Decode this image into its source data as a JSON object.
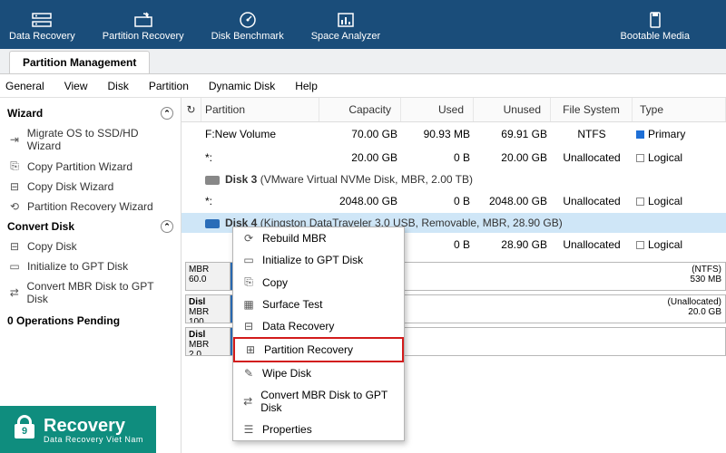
{
  "topbar": {
    "items": [
      {
        "label": "Data Recovery"
      },
      {
        "label": "Partition Recovery"
      },
      {
        "label": "Disk Benchmark"
      },
      {
        "label": "Space Analyzer"
      }
    ],
    "right": {
      "label": "Bootable Media"
    }
  },
  "tabs": {
    "active": "Partition Management"
  },
  "menu": [
    "General",
    "View",
    "Disk",
    "Partition",
    "Dynamic Disk",
    "Help"
  ],
  "sidebar": {
    "wizard_head": "Wizard",
    "wizard": [
      "Migrate OS to SSD/HD Wizard",
      "Copy Partition Wizard",
      "Copy Disk Wizard",
      "Partition Recovery Wizard"
    ],
    "convert_head": "Convert Disk",
    "convert": [
      "Copy Disk",
      "Initialize to GPT Disk",
      "Convert MBR Disk to GPT Disk"
    ],
    "pending": "0 Operations Pending"
  },
  "grid": {
    "headers": {
      "part": "Partition",
      "cap": "Capacity",
      "used": "Used",
      "unused": "Unused",
      "fs": "File System",
      "type": "Type"
    },
    "rows": [
      {
        "part": "F:New Volume",
        "cap": "70.00 GB",
        "used": "90.93 MB",
        "unused": "69.91 GB",
        "fs": "NTFS",
        "type": "Primary",
        "chip": "blue"
      },
      {
        "part": "*:",
        "cap": "20.00 GB",
        "used": "0 B",
        "unused": "20.00 GB",
        "fs": "Unallocated",
        "type": "Logical",
        "chip": "gray"
      }
    ],
    "disk3": {
      "name": "Disk 3",
      "desc": "(VMware Virtual NVMe Disk, MBR, 2.00 TB)"
    },
    "row_d3": {
      "part": "*:",
      "cap": "2048.00 GB",
      "used": "0 B",
      "unused": "2048.00 GB",
      "fs": "Unallocated",
      "type": "Logical",
      "chip": "gray"
    },
    "disk4": {
      "name": "Disk 4",
      "desc": "(Kingston DataTraveler 3.0 USB, Removable, MBR, 28.90 GB)"
    },
    "row_d4": {
      "part": "",
      "cap": "",
      "used": "0 B",
      "unused": "28.90 GB",
      "fs": "Unallocated",
      "type": "Logical",
      "chip": "gray"
    }
  },
  "blocks": {
    "a": {
      "label": "MBR",
      "size": "60.0"
    },
    "b": {
      "name": "Disl",
      "label": "MBR",
      "size": "100"
    },
    "c": {
      "name": "Disl",
      "label": "MBR",
      "size": "2.0"
    },
    "right1": {
      "fs": "(NTFS)",
      "size": "530 MB"
    },
    "right2": {
      "fs": "(Unallocated)",
      "size": "20.0 GB"
    }
  },
  "ctx": [
    "Rebuild MBR",
    "Initialize to GPT Disk",
    "Copy",
    "Surface Test",
    "Data Recovery",
    "Partition Recovery",
    "Wipe Disk",
    "Convert MBR Disk to GPT Disk",
    "Properties"
  ],
  "watermark": {
    "big": "Recovery",
    "small": "Data Recovery Viet Nam",
    "num": "9"
  }
}
